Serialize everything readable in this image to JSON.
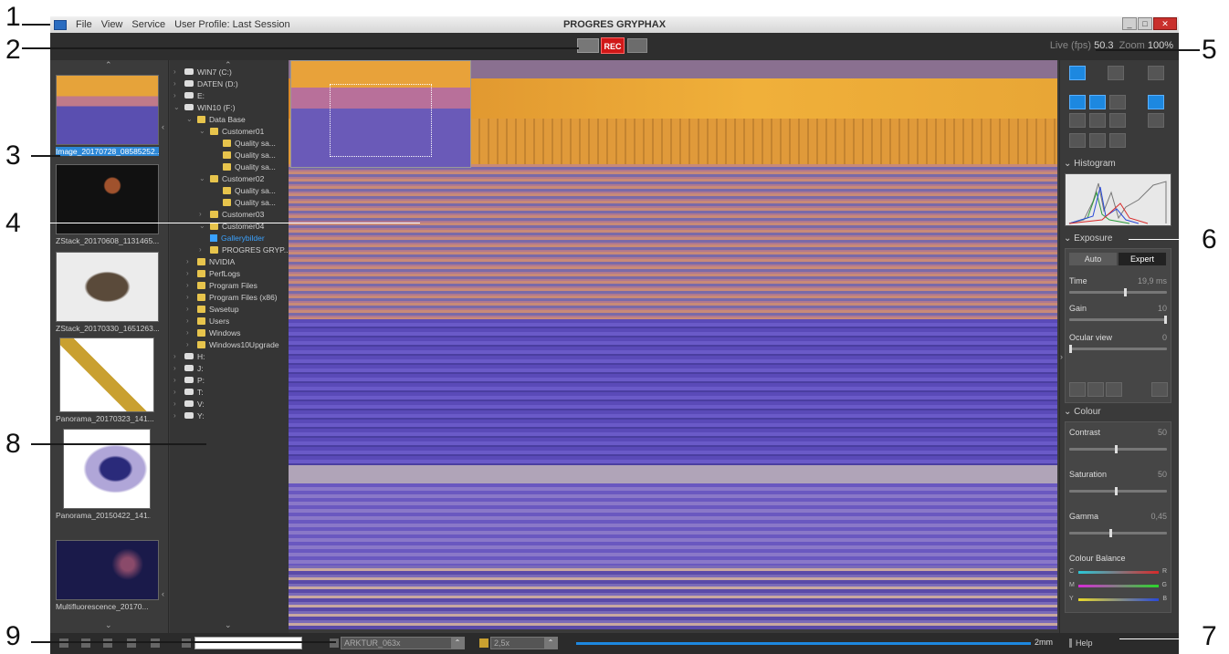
{
  "app": {
    "title": "PROGRES GRYPHAX",
    "menu": [
      "File",
      "View",
      "Service",
      "User Profile: Last Session"
    ]
  },
  "toolbar": {
    "rec_label": "REC",
    "live_label": "Live (fps)",
    "fps": "50.3",
    "zoom_label": "Zoom",
    "zoom": "100%"
  },
  "gallery": [
    {
      "caption": "Image_20170728_08585252...",
      "selected": true
    },
    {
      "caption": "ZStack_20170608_1131465...",
      "selected": false
    },
    {
      "caption": "ZStack_20170330_1651263...",
      "selected": false
    },
    {
      "caption": "Panorama_20170323_141...",
      "selected": false
    },
    {
      "caption": "Panorama_20150422_141...",
      "selected": false
    },
    {
      "caption": "Multifluorescence_20170...",
      "selected": false
    }
  ],
  "tree": [
    {
      "label": "WIN7 (C:)",
      "type": "drive",
      "indent": 0,
      "exp": ">"
    },
    {
      "label": "DATEN (D:)",
      "type": "drive",
      "indent": 0,
      "exp": ">"
    },
    {
      "label": "E:",
      "type": "drive",
      "indent": 0,
      "exp": ">"
    },
    {
      "label": "WIN10 (F:)",
      "type": "drive",
      "indent": 0,
      "exp": "v"
    },
    {
      "label": "Data Base",
      "type": "folder",
      "indent": 1,
      "exp": "v"
    },
    {
      "label": "Customer01",
      "type": "folder",
      "indent": 2,
      "exp": "v"
    },
    {
      "label": "Quality sa...",
      "type": "folder",
      "indent": 3,
      "exp": ""
    },
    {
      "label": "Quality sa...",
      "type": "folder",
      "indent": 3,
      "exp": ""
    },
    {
      "label": "Quality sa...",
      "type": "folder",
      "indent": 3,
      "exp": ""
    },
    {
      "label": "Customer02",
      "type": "folder",
      "indent": 2,
      "exp": "v"
    },
    {
      "label": "Quality sa...",
      "type": "folder",
      "indent": 3,
      "exp": ""
    },
    {
      "label": "Quality sa...",
      "type": "folder",
      "indent": 3,
      "exp": ""
    },
    {
      "label": "Customer03",
      "type": "folder",
      "indent": 2,
      "exp": ">"
    },
    {
      "label": "Customer04",
      "type": "folder",
      "indent": 2,
      "exp": "v"
    },
    {
      "label": "Gallerybilder",
      "type": "sel",
      "indent": 2,
      "exp": ""
    },
    {
      "label": "PROGRES GRYP...",
      "type": "folder",
      "indent": 2,
      "exp": ">"
    },
    {
      "label": "NVIDIA",
      "type": "folder",
      "indent": 1,
      "exp": ">"
    },
    {
      "label": "PerfLogs",
      "type": "folder",
      "indent": 1,
      "exp": ">"
    },
    {
      "label": "Program Files",
      "type": "folder",
      "indent": 1,
      "exp": ">"
    },
    {
      "label": "Program Files (x86)",
      "type": "folder",
      "indent": 1,
      "exp": ">"
    },
    {
      "label": "Swsetup",
      "type": "folder",
      "indent": 1,
      "exp": ">"
    },
    {
      "label": "Users",
      "type": "folder",
      "indent": 1,
      "exp": ">"
    },
    {
      "label": "Windows",
      "type": "folder",
      "indent": 1,
      "exp": ">"
    },
    {
      "label": "Windows10Upgrade",
      "type": "folder",
      "indent": 1,
      "exp": ">"
    },
    {
      "label": "H:",
      "type": "drive",
      "indent": 0,
      "exp": ">"
    },
    {
      "label": "J:",
      "type": "drive",
      "indent": 0,
      "exp": ">"
    },
    {
      "label": "P:",
      "type": "drive",
      "indent": 0,
      "exp": ">"
    },
    {
      "label": "T:",
      "type": "drive",
      "indent": 0,
      "exp": ">"
    },
    {
      "label": "V:",
      "type": "drive",
      "indent": 0,
      "exp": ">"
    },
    {
      "label": "Y:",
      "type": "drive",
      "indent": 0,
      "exp": ">"
    }
  ],
  "panel": {
    "histogram_title": "Histogram",
    "exposure_title": "Exposure",
    "auto_label": "Auto",
    "expert_label": "Expert",
    "time_label": "Time",
    "time_value": "19,9 ms",
    "gain_label": "Gain",
    "gain_value": "10",
    "ocular_label": "Ocular view",
    "ocular_value": "0",
    "colour_title": "Colour",
    "contrast_label": "Contrast",
    "contrast_value": "50",
    "saturation_label": "Saturation",
    "saturation_value": "50",
    "gamma_label": "Gamma",
    "gamma_value": "0,45",
    "balance_title": "Colour Balance",
    "balance": [
      {
        "left": "C",
        "right": "R"
      },
      {
        "left": "M",
        "right": "G"
      },
      {
        "left": "Y",
        "right": "B"
      }
    ]
  },
  "statusbar": {
    "objective": "ARKTUR_063x",
    "zoom_factor": "2,5x",
    "scale_label": "2mm",
    "help_label": "Help"
  },
  "callouts": [
    "1",
    "2",
    "3",
    "4",
    "5",
    "6",
    "7",
    "8",
    "9"
  ]
}
